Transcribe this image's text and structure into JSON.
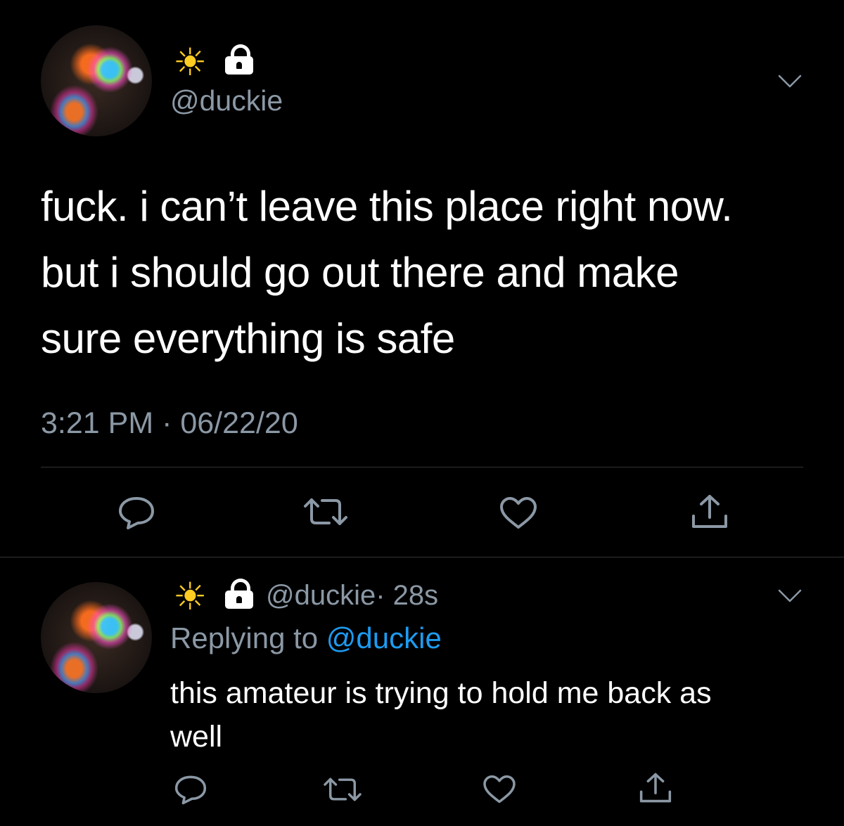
{
  "tweet": {
    "sun_emoji": "☀",
    "handle": "@duckie",
    "text_lines": [
      "fuck. i can’t leave this place right now.",
      "but i should go out there and make",
      "sure everything is safe"
    ],
    "timestamp": "3:21 PM · 06/22/20"
  },
  "reply": {
    "sun_emoji": "☀",
    "handle": "@duckie",
    "age": "· 28s",
    "replying_prefix": "Replying to",
    "replying_handle": "@duckie",
    "text_lines": [
      "this amateur is trying to hold me back as",
      "well"
    ]
  },
  "icons": {
    "reply": "comment-icon",
    "retweet": "retweet-icon",
    "like": "heart-icon",
    "share": "share-icon",
    "menu": "chevron-down-icon"
  },
  "colors": {
    "background": "#000000",
    "text": "#ffffff",
    "muted": "#8b98a5",
    "link": "#1d9bf0",
    "divider": "#2f3336",
    "sun": "#ffcc22"
  }
}
